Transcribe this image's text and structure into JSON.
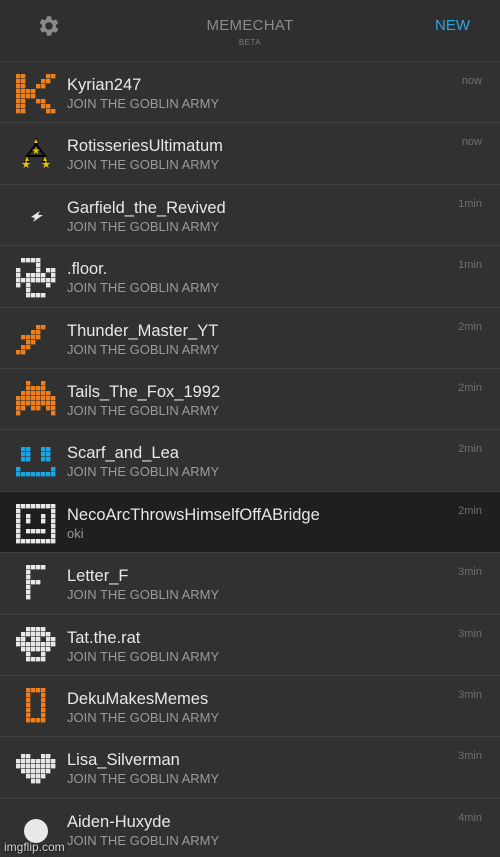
{
  "header": {
    "settings_icon": "gear-icon",
    "title": "MEMECHAT",
    "subtitle": "BETA",
    "new_label": "NEW"
  },
  "colors": {
    "accent": "#2aa6e8",
    "orange": "#f07f1a",
    "blue": "#1aa6e6",
    "white": "#e8e8e8"
  },
  "chats": [
    {
      "name": "Kyrian247",
      "message": "JOIN THE GOBLIN ARMY",
      "time": "now",
      "avatar": "orange-k-icon"
    },
    {
      "name": "RotisseriesUltimatum",
      "message": "JOIN THE GOBLIN ARMY",
      "time": "now",
      "avatar": "three-stars-icon"
    },
    {
      "name": "Garfield_the_Revived",
      "message": "JOIN THE GOBLIN ARMY",
      "time": "1min",
      "avatar": "lightning-bolt-icon"
    },
    {
      "name": ".floor.",
      "message": "JOIN THE GOBLIN ARMY",
      "time": "1min",
      "avatar": "white-pixel-cross-icon"
    },
    {
      "name": "Thunder_Master_YT",
      "message": "JOIN THE GOBLIN ARMY",
      "time": "2min",
      "avatar": "orange-lightning-icon"
    },
    {
      "name": "Tails_The_Fox_1992",
      "message": "JOIN THE GOBLIN ARMY",
      "time": "2min",
      "avatar": "orange-invader-icon"
    },
    {
      "name": "Scarf_and_Lea",
      "message": "JOIN THE GOBLIN ARMY",
      "time": "2min",
      "avatar": "blue-smile-icon"
    },
    {
      "name": "NecoArcThrowsHimselfOffABridge",
      "message": "oki",
      "time": "2min",
      "avatar": "white-pixel-face-icon"
    },
    {
      "name": "Letter_F",
      "message": "JOIN THE GOBLIN ARMY",
      "time": "3min",
      "avatar": "white-letter-f-icon"
    },
    {
      "name": "Tat.the.rat",
      "message": "JOIN THE GOBLIN ARMY",
      "time": "3min",
      "avatar": "white-skull-icon"
    },
    {
      "name": "DekuMakesMemes",
      "message": "JOIN THE GOBLIN ARMY",
      "time": "3min",
      "avatar": "orange-letter-d-icon"
    },
    {
      "name": "Lisa_Silverman",
      "message": "JOIN THE GOBLIN ARMY",
      "time": "3min",
      "avatar": "white-heart-icon"
    },
    {
      "name": "Aiden-Huxyde",
      "message": "JOIN THE GOBLIN ARMY",
      "time": "4min",
      "avatar": "default-user-icon"
    }
  ],
  "active_index": 7,
  "watermark": "imgflip.com"
}
